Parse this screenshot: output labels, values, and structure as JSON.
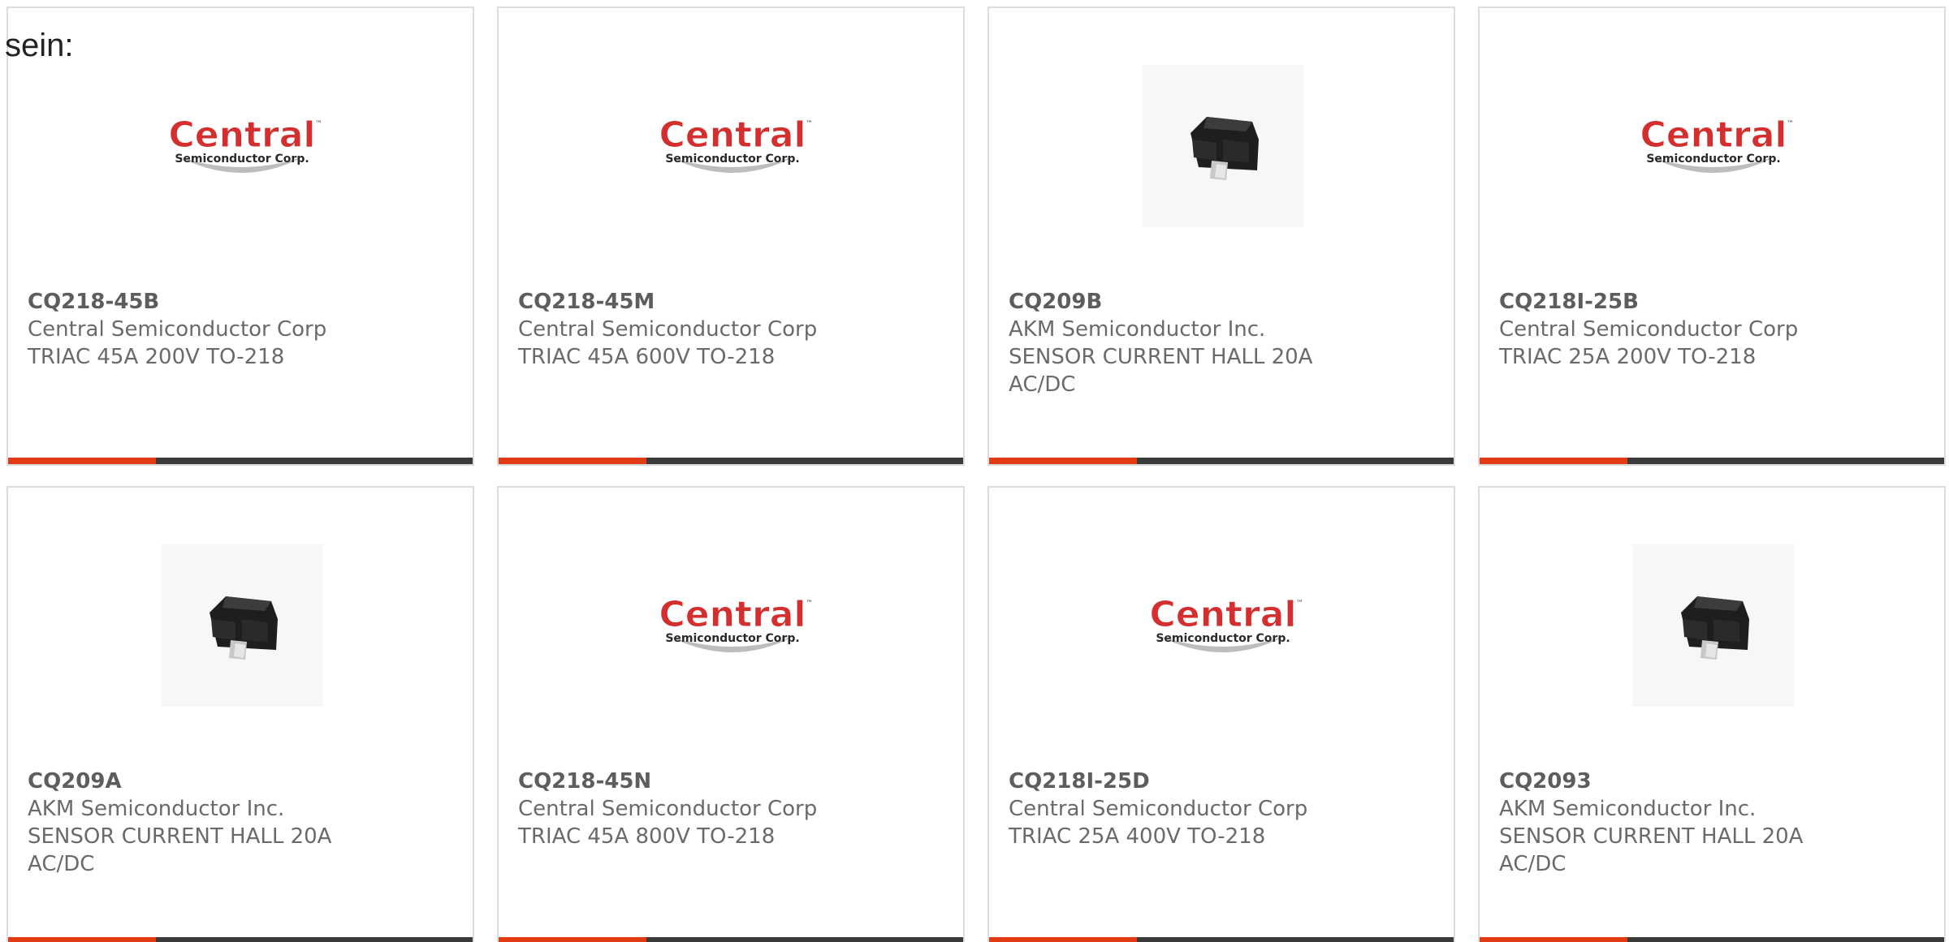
{
  "intro_text": "sein:",
  "colors": {
    "accent": "#e23a12",
    "bar": "#3a3a3a",
    "text": "#6a6a6a",
    "border": "#dcdcdc",
    "logo_red": "#d32f2f"
  },
  "logo": {
    "name": "Central",
    "tagline": "Semiconductor Corp."
  },
  "products": [
    {
      "part": "CQ218-45B",
      "maker": "Central Semiconductor Corp",
      "desc": "TRIAC 45A 200V TO-218",
      "image": "central-logo"
    },
    {
      "part": "CQ218-45M",
      "maker": "Central Semiconductor Corp",
      "desc": "TRIAC 45A 600V TO-218",
      "image": "central-logo"
    },
    {
      "part": "CQ209B",
      "maker": "AKM Semiconductor Inc.",
      "desc": "SENSOR CURRENT HALL 20A AC/DC",
      "image": "sensor-chip"
    },
    {
      "part": "CQ218I-25B",
      "maker": "Central Semiconductor Corp",
      "desc": "TRIAC 25A 200V TO-218",
      "image": "central-logo"
    },
    {
      "part": "CQ209A",
      "maker": "AKM Semiconductor Inc.",
      "desc": "SENSOR CURRENT HALL 20A AC/DC",
      "image": "sensor-chip"
    },
    {
      "part": "CQ218-45N",
      "maker": "Central Semiconductor Corp",
      "desc": "TRIAC 45A 800V TO-218",
      "image": "central-logo"
    },
    {
      "part": "CQ218I-25D",
      "maker": "Central Semiconductor Corp",
      "desc": "TRIAC 25A 400V TO-218",
      "image": "central-logo"
    },
    {
      "part": "CQ2093",
      "maker": "AKM Semiconductor Inc.",
      "desc": "SENSOR CURRENT HALL 20A AC/DC",
      "image": "sensor-chip"
    }
  ]
}
